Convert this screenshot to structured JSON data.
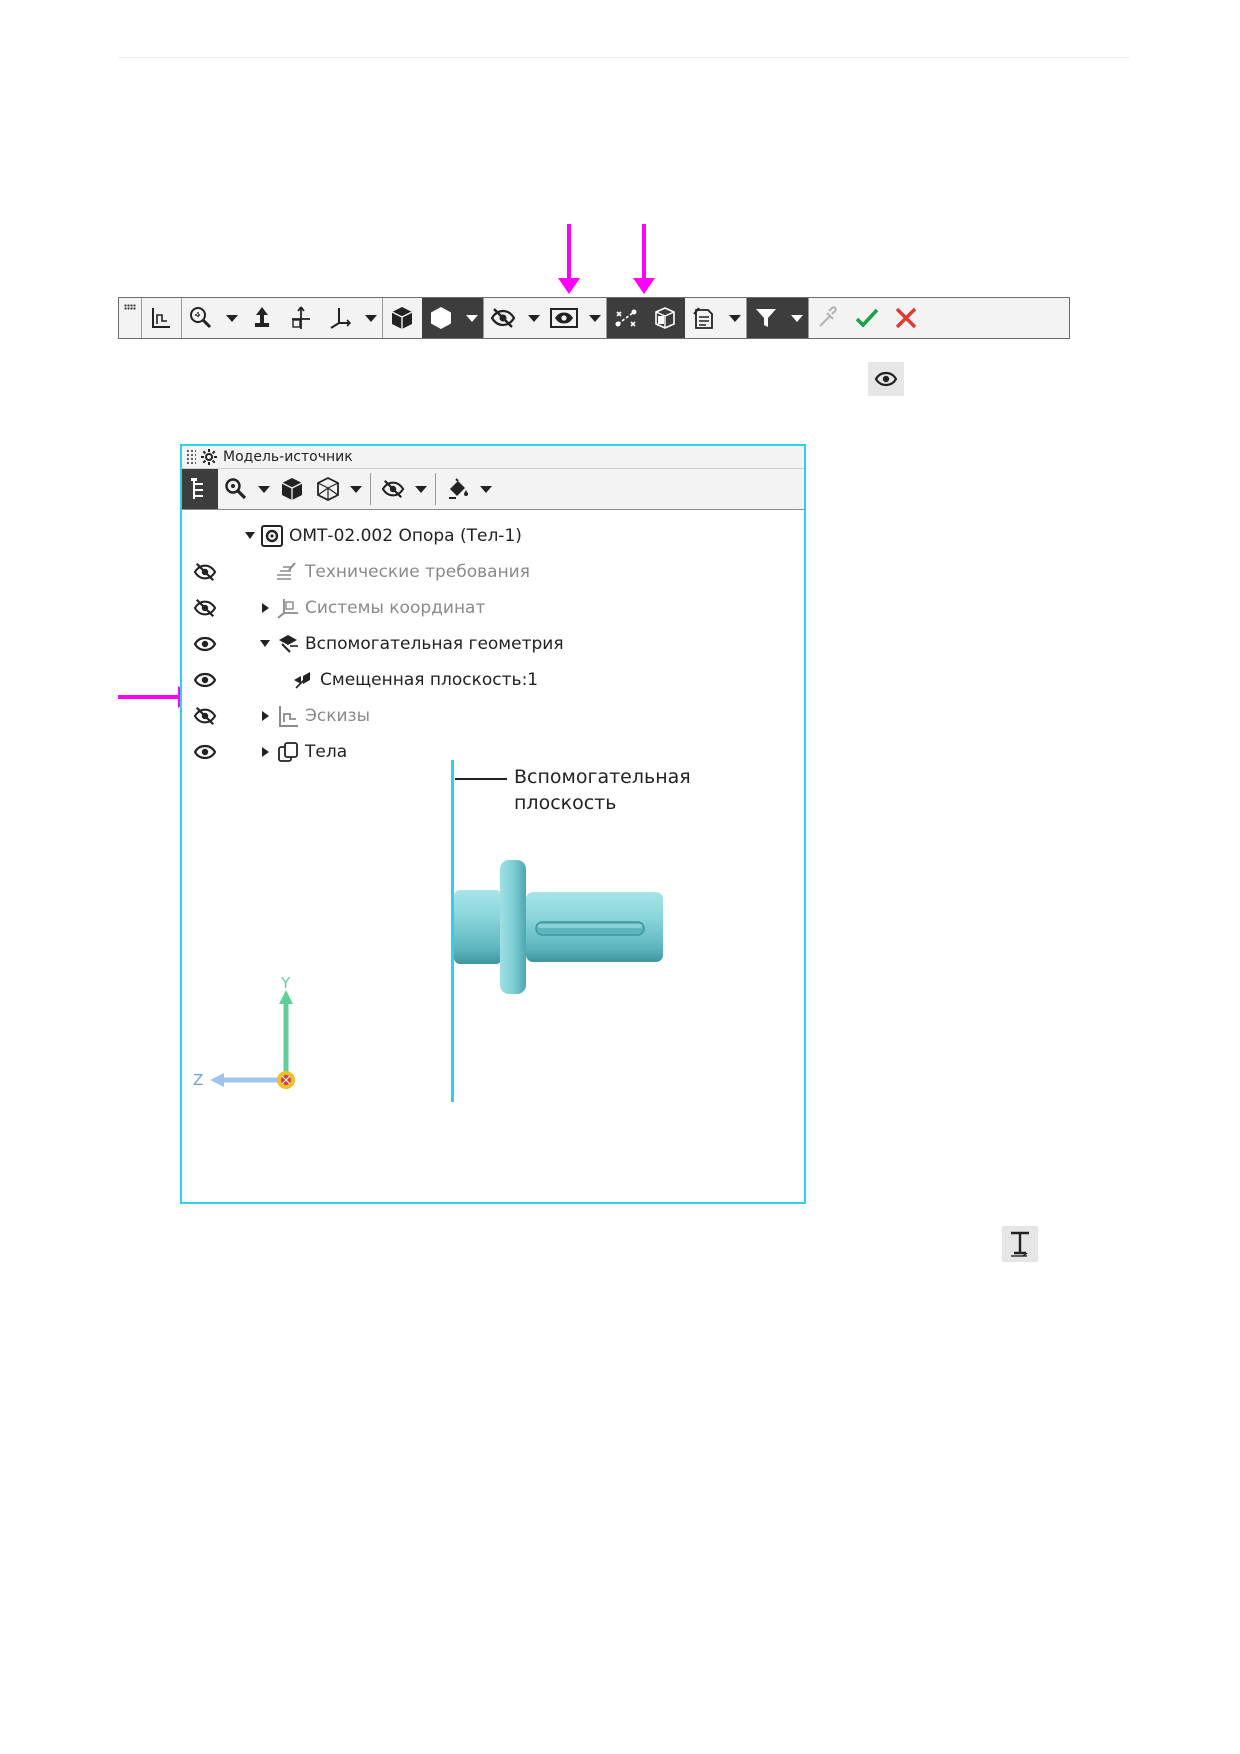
{
  "panel": {
    "title": "Модель-источник",
    "tree": [
      {
        "label": "ОМТ-02.002 Опора (Тел-1)",
        "visibility": "none",
        "expander": "down",
        "state": "normal",
        "icon": "part-icon"
      },
      {
        "label": "Технические требования",
        "visibility": "hidden",
        "expander": "none",
        "state": "muted",
        "icon": "tech-requirements-icon"
      },
      {
        "label": "Системы координат",
        "visibility": "hidden",
        "expander": "right",
        "state": "muted",
        "icon": "coordinate-systems-icon"
      },
      {
        "label": "Вспомогательная геометрия",
        "visibility": "visible",
        "expander": "down",
        "state": "normal",
        "icon": "auxiliary-geometry-icon"
      },
      {
        "label": "Смещенная плоскость:1",
        "visibility": "visible",
        "expander": "none",
        "state": "normal",
        "icon": "offset-plane-icon"
      },
      {
        "label": "Эскизы",
        "visibility": "hidden",
        "expander": "right",
        "state": "muted",
        "icon": "sketches-icon"
      },
      {
        "label": "Тела",
        "visibility": "visible",
        "expander": "right",
        "state": "normal",
        "icon": "bodies-icon"
      }
    ]
  },
  "viewport": {
    "callout_line1": "Вспомогательная",
    "callout_line2": "плоскость",
    "axis_y": "Y",
    "axis_z": "Z"
  },
  "colors": {
    "accent_magenta": "#ff00ff",
    "plane_cyan": "#2fd1e6",
    "part_teal": "#7fd0d6",
    "confirm_green": "#1aa34a",
    "cancel_red": "#e03a2f"
  }
}
